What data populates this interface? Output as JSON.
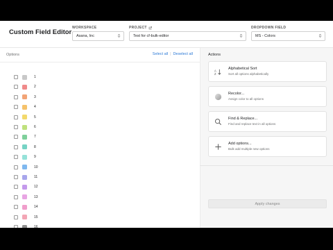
{
  "header": {
    "title": "Custom Field Editor",
    "workspace": {
      "label": "WORKSPACE",
      "value": "Asana, Inc"
    },
    "project": {
      "label": "PROJECT",
      "value": "Test for cf-bulk-editor"
    },
    "dropdown_field": {
      "label": "DROPDOWN FIELD",
      "value": "MS - Colors"
    }
  },
  "options_panel": {
    "title": "Options",
    "select_all": "Select all",
    "deselect_all": "Deselect all",
    "items": [
      {
        "label": "1",
        "color": "#c8c8c8"
      },
      {
        "label": "2",
        "color": "#f08a8a"
      },
      {
        "label": "3",
        "color": "#f2a476"
      },
      {
        "label": "4",
        "color": "#f5c26b"
      },
      {
        "label": "5",
        "color": "#f3d96c"
      },
      {
        "label": "6",
        "color": "#bfe17d"
      },
      {
        "label": "7",
        "color": "#7fd09b"
      },
      {
        "label": "8",
        "color": "#76d3c5"
      },
      {
        "label": "9",
        "color": "#96e2d9"
      },
      {
        "label": "10",
        "color": "#7fb8ef"
      },
      {
        "label": "11",
        "color": "#a8a6ec"
      },
      {
        "label": "12",
        "color": "#c49aec"
      },
      {
        "label": "13",
        "color": "#e8a5e3"
      },
      {
        "label": "14",
        "color": "#f09ecb"
      },
      {
        "label": "15",
        "color": "#f3a6b5"
      },
      {
        "label": "16",
        "color": "#8f8f8f"
      }
    ]
  },
  "actions_panel": {
    "title": "Actions",
    "actions": [
      {
        "title": "Alphabetical Sort",
        "desc": "Sort all options alphabetically",
        "icon": "sort-icon"
      },
      {
        "title": "Recolor...",
        "desc": "Assign color to all options",
        "icon": "color-circle-icon"
      },
      {
        "title": "Find & Replace...",
        "desc": "Find and replace text in all options",
        "icon": "search-icon"
      },
      {
        "title": "Add options...",
        "desc": "Bulk add multiple new options",
        "icon": "plus-icon"
      }
    ],
    "apply_label": "Apply changes"
  }
}
